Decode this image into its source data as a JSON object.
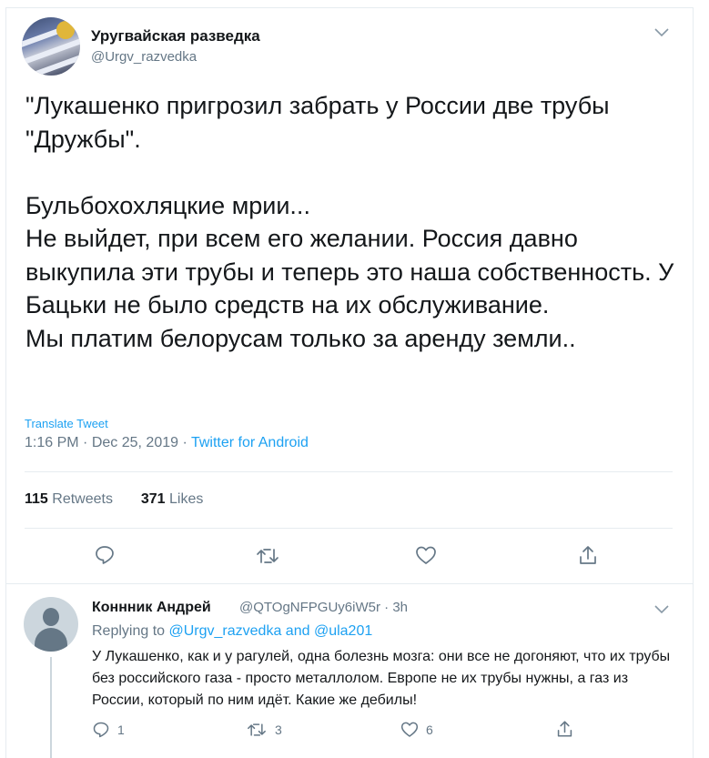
{
  "tweet": {
    "author_name": "Уругвайская разведка",
    "author_handle": "@Urgv_razvedka",
    "text": "\"Лукашенко пригрозил забрать у России две трубы \"Дружбы\".\n\nБульбохохляцкие мрии...\nНе выйдет, при всем его желании. Россия давно выкупила эти трубы и теперь это наша собственность. У Бацьки не было средств на их обслуживание.\nМы платим белорусам только за аренду земли..",
    "translate_label": "Translate Tweet",
    "time": "1:16 PM",
    "date": "Dec 25, 2019",
    "separator": "·",
    "source": "Twitter for Android",
    "retweets_count": "115",
    "retweets_label": "Retweets",
    "likes_count": "371",
    "likes_label": "Likes"
  },
  "reply": {
    "author_name": "Коннник Андрей",
    "author_handle": "@QTOgNFPGUy6iW5r",
    "age": "3h",
    "separator": "·",
    "replying_prefix": "Replying to",
    "replying_user1": "@Urgv_razvedka",
    "replying_and": "and",
    "replying_user2": "@ula201",
    "text": "У Лукашенко, как и у рагулей, одна болезнь мозга: они все не догоняют, что их трубы без российского газа - просто металлолом. Европе не их трубы нужны, а газ из России, который по ним идёт. Какие же дебилы!",
    "reply_count": "1",
    "retweet_count": "3",
    "like_count": "6"
  },
  "icons": {
    "reply": "reply-icon",
    "retweet": "retweet-icon",
    "like": "heart-icon",
    "share": "share-icon",
    "more": "chevron-down-icon"
  },
  "colors": {
    "link": "#1da1f2",
    "secondary_text": "#657786",
    "primary_text": "#14171a",
    "divider": "#e6ecf0"
  }
}
